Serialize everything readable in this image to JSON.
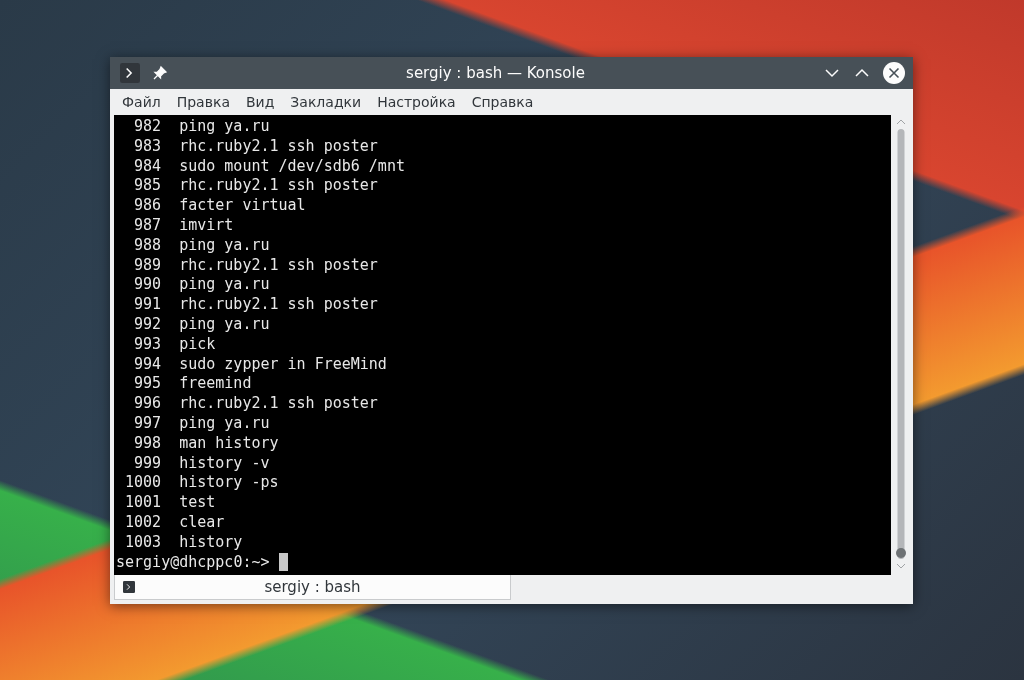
{
  "window": {
    "title": "sergiy : bash — Konsole"
  },
  "menu": [
    "Файл",
    "Правка",
    "Вид",
    "Закладки",
    "Настройка",
    "Справка"
  ],
  "history": [
    {
      "number": "982",
      "command": "ping ya.ru"
    },
    {
      "number": "983",
      "command": "rhc.ruby2.1 ssh poster"
    },
    {
      "number": "984",
      "command": "sudo mount /dev/sdb6 /mnt"
    },
    {
      "number": "985",
      "command": "rhc.ruby2.1 ssh poster"
    },
    {
      "number": "986",
      "command": "facter virtual"
    },
    {
      "number": "987",
      "command": "imvirt"
    },
    {
      "number": "988",
      "command": "ping ya.ru"
    },
    {
      "number": "989",
      "command": "rhc.ruby2.1 ssh poster"
    },
    {
      "number": "990",
      "command": "ping ya.ru"
    },
    {
      "number": "991",
      "command": "rhc.ruby2.1 ssh poster"
    },
    {
      "number": "992",
      "command": "ping ya.ru"
    },
    {
      "number": "993",
      "command": "pick"
    },
    {
      "number": "994",
      "command": "sudo zypper in FreeMind"
    },
    {
      "number": "995",
      "command": "freemind"
    },
    {
      "number": "996",
      "command": "rhc.ruby2.1 ssh poster"
    },
    {
      "number": "997",
      "command": "ping ya.ru"
    },
    {
      "number": "998",
      "command": "man history"
    },
    {
      "number": "999",
      "command": "history -v"
    },
    {
      "number": "1000",
      "command": "history -ps"
    },
    {
      "number": "1001",
      "command": "test"
    },
    {
      "number": "1002",
      "command": "clear"
    },
    {
      "number": "1003",
      "command": "history"
    }
  ],
  "prompt": "sergiy@dhcppc0:~>",
  "tabs": [
    {
      "label": "sergiy : bash",
      "selected": true
    }
  ]
}
